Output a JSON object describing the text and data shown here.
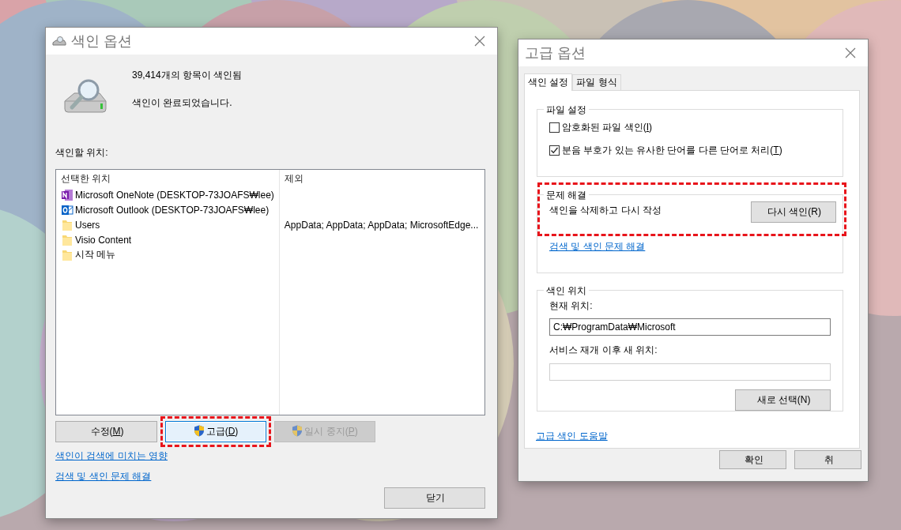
{
  "index_options": {
    "title": "색인 옵션",
    "count_text": "39,414개의 항목이 색인됨",
    "status_text": "색인이 완료되었습니다.",
    "locations_label": "색인할 위치:",
    "columns": [
      "선택한 위치",
      "제외"
    ],
    "rows": [
      {
        "kind": "onenote",
        "location": "Microsoft OneNote (DESKTOP-73JOAFS₩lee)"
      },
      {
        "kind": "outlook",
        "location": "Microsoft Outlook (DESKTOP-73JOAFS₩lee)"
      },
      {
        "kind": "folder",
        "location": "Users",
        "exclude": "AppData; AppData; AppData; MicrosoftEdge..."
      },
      {
        "kind": "folder",
        "location": "Visio Content"
      },
      {
        "kind": "folder",
        "location": "시작 메뉴"
      }
    ],
    "buttons": [
      {
        "label": "수정(M)",
        "shield": false,
        "disabled": false,
        "highlighted": false
      },
      {
        "label": "고급(D)",
        "shield": true,
        "disabled": false,
        "highlighted": true
      },
      {
        "label": "일시 중지(P)",
        "shield": true,
        "disabled": true,
        "highlighted": false
      }
    ],
    "links": [
      "색인이 검색에 미치는 영향",
      "검색 및 색인 문제 해결"
    ],
    "close_button": "닫기"
  },
  "advanced_options": {
    "title": "고급 옵션",
    "tabs": [
      {
        "label": "색인 설정",
        "selected": true
      },
      {
        "label": "파일 형식",
        "selected": false
      }
    ],
    "file_settings": {
      "title": "파일 설정",
      "options": [
        {
          "label": "암호화된 파일 색인(I)",
          "checked": false
        },
        {
          "label": "분음 부호가 있는 유사한 단어를 다른 단어로 처리(T)",
          "checked": true
        }
      ]
    },
    "troubleshooting": {
      "title": "문제 해결",
      "highlighted": true,
      "text": "색인을 삭제하고 다시 작성",
      "button": "다시 색인(R)",
      "link": "검색 및 색인 문제 해결"
    },
    "index_location": {
      "title": "색인 위치",
      "current_label": "현재 위치:",
      "current_value": "C:₩ProgramData₩Microsoft",
      "new_label": "서비스 재개 이후 새 위치:",
      "button": "새로 선택(N)"
    },
    "help_link": "고급 색인 도움말",
    "buttons": [
      "확인",
      "취"
    ]
  }
}
